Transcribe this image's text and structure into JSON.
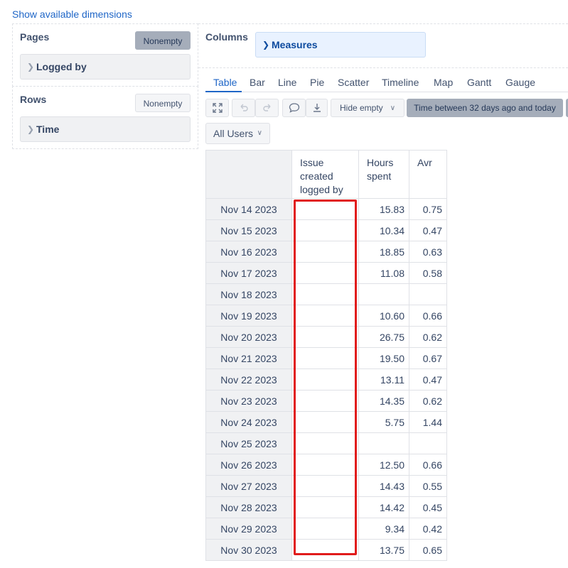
{
  "top_link": "Show available dimensions",
  "pages": {
    "title": "Pages",
    "nonempty_label": "Nonempty",
    "dimension": "Logged by"
  },
  "rows": {
    "title": "Rows",
    "nonempty_label": "Nonempty",
    "dimension": "Time"
  },
  "columns": {
    "title": "Columns",
    "dimension": "Measures"
  },
  "tabs": [
    {
      "label": "Table",
      "active": true
    },
    {
      "label": "Bar"
    },
    {
      "label": "Line"
    },
    {
      "label": "Pie"
    },
    {
      "label": "Scatter"
    },
    {
      "label": "Timeline"
    },
    {
      "label": "Map"
    },
    {
      "label": "Gantt"
    },
    {
      "label": "Gauge"
    }
  ],
  "toolbar": {
    "hide_empty_label": "Hide empty",
    "time_filter_label": "Time between 32 days ago and today",
    "user_filter_label": "All Users"
  },
  "table": {
    "headers": [
      "Issue created logged by",
      "Hours spent",
      "Avr"
    ],
    "rows": [
      {
        "date": "Nov 14 2023",
        "issue": "",
        "hours": "15.83",
        "avr": "0.75"
      },
      {
        "date": "Nov 15 2023",
        "issue": "",
        "hours": "10.34",
        "avr": "0.47"
      },
      {
        "date": "Nov 16 2023",
        "issue": "",
        "hours": "18.85",
        "avr": "0.63"
      },
      {
        "date": "Nov 17 2023",
        "issue": "",
        "hours": "11.08",
        "avr": "0.58"
      },
      {
        "date": "Nov 18 2023",
        "issue": "",
        "hours": "",
        "avr": ""
      },
      {
        "date": "Nov 19 2023",
        "issue": "",
        "hours": "10.60",
        "avr": "0.66"
      },
      {
        "date": "Nov 20 2023",
        "issue": "",
        "hours": "26.75",
        "avr": "0.62"
      },
      {
        "date": "Nov 21 2023",
        "issue": "",
        "hours": "19.50",
        "avr": "0.67"
      },
      {
        "date": "Nov 22 2023",
        "issue": "",
        "hours": "13.11",
        "avr": "0.47"
      },
      {
        "date": "Nov 23 2023",
        "issue": "",
        "hours": "14.35",
        "avr": "0.62"
      },
      {
        "date": "Nov 24 2023",
        "issue": "",
        "hours": "5.75",
        "avr": "1.44"
      },
      {
        "date": "Nov 25 2023",
        "issue": "",
        "hours": "",
        "avr": ""
      },
      {
        "date": "Nov 26 2023",
        "issue": "",
        "hours": "12.50",
        "avr": "0.66"
      },
      {
        "date": "Nov 27 2023",
        "issue": "",
        "hours": "14.43",
        "avr": "0.55"
      },
      {
        "date": "Nov 28 2023",
        "issue": "",
        "hours": "14.42",
        "avr": "0.45"
      },
      {
        "date": "Nov 29 2023",
        "issue": "",
        "hours": "9.34",
        "avr": "0.42"
      },
      {
        "date": "Nov 30 2023",
        "issue": "",
        "hours": "13.75",
        "avr": "0.65"
      }
    ]
  },
  "colors": {
    "link": "#1f66c7",
    "highlight": "#e11b1b",
    "active_button": "#a5adba"
  }
}
